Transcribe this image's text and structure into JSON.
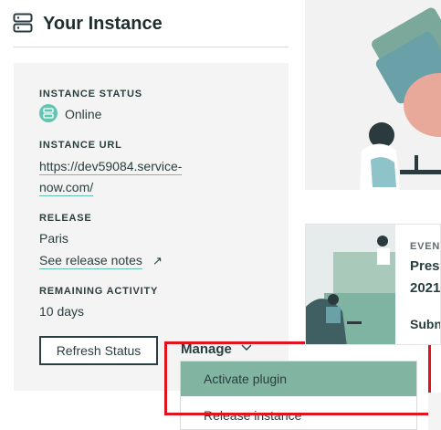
{
  "header": {
    "title": "Your Instance",
    "icon": "server-icon"
  },
  "instance": {
    "status_label": "INSTANCE STATUS",
    "status_value": "Online",
    "status_color": "#62c4b1",
    "url_label": "INSTANCE URL",
    "url_line1": "https://dev59084.service-",
    "url_line2": "now.com/",
    "release_label": "RELEASE",
    "release_value": "Paris",
    "release_notes_link": "See release notes",
    "remaining_label": "REMAINING ACTIVITY",
    "remaining_value": "10 days"
  },
  "actions": {
    "refresh_label": "Refresh Status",
    "manage_label": "Manage"
  },
  "dropdown": {
    "items": [
      {
        "label": "Activate plugin",
        "active": true
      },
      {
        "label": "Release instance",
        "active": false
      }
    ]
  },
  "event": {
    "label": "EVEN",
    "title_line1": "Prese",
    "title_line2": "2021",
    "sub": "Subn"
  },
  "colors": {
    "accent": "#62c4b1",
    "menu_active": "#81b5a1",
    "highlight": "#e0141e"
  }
}
